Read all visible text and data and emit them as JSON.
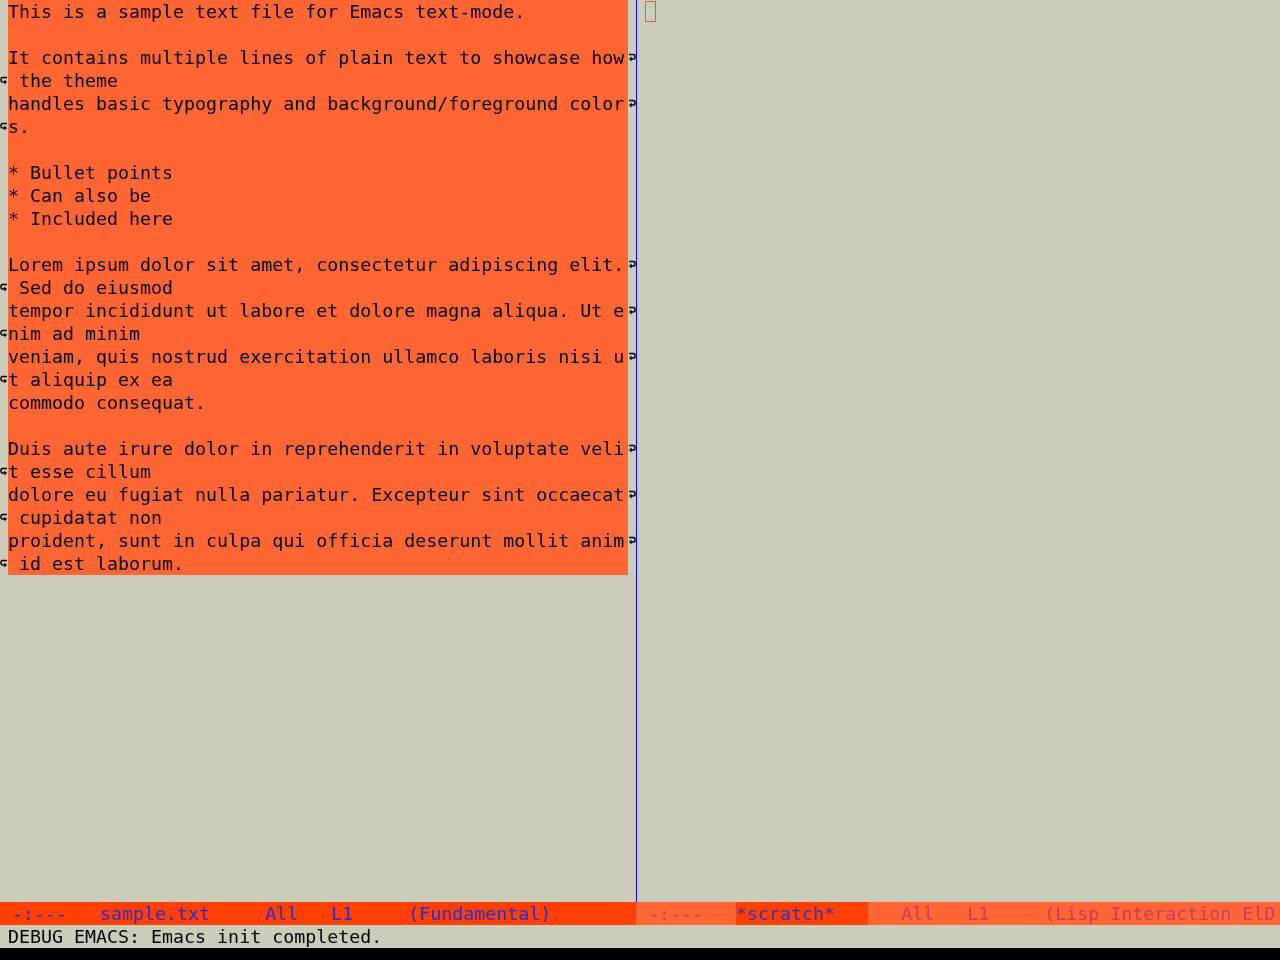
{
  "windows": [
    {
      "active": true,
      "paragraphs": [
        {
          "lines": [
            [
              "This is a sample text file for Emacs text-mode."
            ]
          ]
        },
        {
          "lines": [
            [
              "It contains multiple lines of plain text to showcase how",
              " the theme"
            ],
            [
              "handles basic typography and background/foreground color",
              "s."
            ]
          ]
        },
        {
          "lines": [
            [
              "* Bullet points"
            ],
            [
              "* Can also be"
            ],
            [
              "* Included here"
            ]
          ]
        },
        {
          "lines": [
            [
              "Lorem ipsum dolor sit amet, consectetur adipiscing elit.",
              " Sed do eiusmod"
            ],
            [
              "tempor incididunt ut labore et dolore magna aliqua. Ut e",
              "nim ad minim"
            ],
            [
              "veniam, quis nostrud exercitation ullamco laboris nisi u",
              "t aliquip ex ea"
            ],
            [
              "commodo consequat."
            ]
          ]
        },
        {
          "lines": [
            [
              "Duis aute irure dolor in reprehenderit in voluptate veli",
              "t esse cillum"
            ],
            [
              "dolore eu fugiat nulla pariatur. Excepteur sint occaecat",
              " cupidatat non"
            ],
            [
              "proident, sunt in culpa qui officia deserunt mollit anim",
              " id est laborum."
            ]
          ]
        }
      ],
      "mode_line": {
        "fields": [
          {
            "kind": "status",
            "text": "-:---"
          },
          {
            "kind": "buffer",
            "text": "sample.txt"
          },
          {
            "kind": "position",
            "text": "All"
          },
          {
            "kind": "line",
            "text": "L1"
          },
          {
            "kind": "mode",
            "text": "(Fundamental)"
          }
        ]
      }
    },
    {
      "active": false,
      "mode_line": {
        "fields": [
          {
            "kind": "status",
            "text": "-:---"
          },
          {
            "kind": "buffer",
            "text": "*scratch*"
          },
          {
            "kind": "position",
            "text": "All"
          },
          {
            "kind": "line",
            "text": "L1"
          },
          {
            "kind": "mode",
            "text": "(Lisp Interaction ElD"
          }
        ]
      }
    }
  ],
  "echo_area": {
    "message": "DEBUG EMACS: Emacs init completed."
  }
}
